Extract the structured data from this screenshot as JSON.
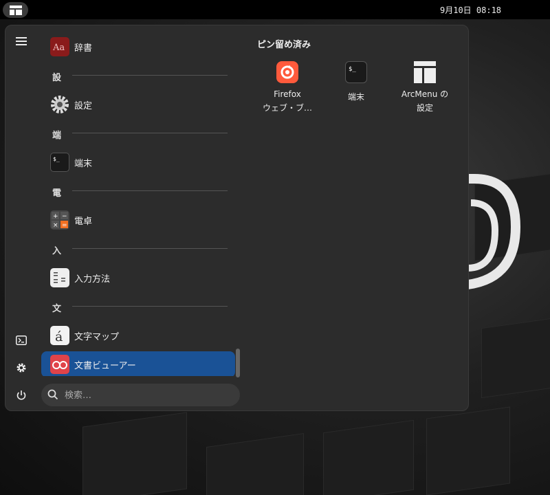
{
  "topbar": {
    "clock": "9月10日 08:18",
    "menu_icon": "arcmenu-icon"
  },
  "menu": {
    "left_rail": {
      "hamburger_icon": "hamburger-icon",
      "terminal_icon": "terminal-icon",
      "settings_icon": "gear-icon",
      "power_icon": "power-icon"
    },
    "apps": {
      "dictionary": "辞書",
      "header_settings": "設",
      "settings": "設定",
      "header_terminal": "端",
      "terminal": "端末",
      "header_calc": "電",
      "calculator": "電卓",
      "header_input": "入",
      "input_method": "入力方法",
      "header_text": "文",
      "charmap": "文字マップ",
      "document_viewer": "文書ビューアー"
    },
    "search": {
      "placeholder": "検索…"
    },
    "pinned": {
      "title": "ピン留め済み",
      "items": [
        {
          "line1": "Firefox",
          "line2": "ウェブ・ブ…"
        },
        {
          "line1": "端末",
          "line2": ""
        },
        {
          "line1": "ArcMenu の",
          "line2": "設定"
        }
      ]
    }
  },
  "colors": {
    "selected": "#1a5296",
    "panel": "#2c2c2c",
    "firefox": "#ff5a3c",
    "calc_orange": "#f37022"
  }
}
